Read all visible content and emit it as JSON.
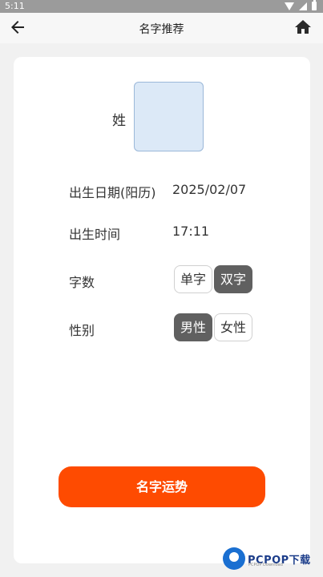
{
  "statusbar": {
    "time": "5:11",
    "icons": [
      "wifi-icon",
      "signal-icon",
      "battery-icon"
    ]
  },
  "appbar": {
    "title": "名字推荐",
    "back_icon": "arrow-left-icon",
    "home_icon": "home-icon"
  },
  "form": {
    "surname_label": "姓",
    "surname_value": "",
    "birth_date_label": "出生日期(阳历)",
    "birth_date_value": "2025/02/07",
    "birth_time_label": "出生时间",
    "birth_time_value": "17:11",
    "char_count_label": "字数",
    "char_count_options": [
      "单字",
      "双字"
    ],
    "char_count_selected": "双字",
    "gender_label": "性别",
    "gender_options": [
      "男性",
      "女性"
    ],
    "gender_selected": "男性"
  },
  "cta": {
    "label": "名字运势"
  },
  "watermark": {
    "text": "PCPOP下载",
    "sub": "PCPOP Download"
  },
  "colors": {
    "accent": "#fe4b01",
    "chip_selected": "#606060",
    "surname_box": "#dce9f7"
  }
}
